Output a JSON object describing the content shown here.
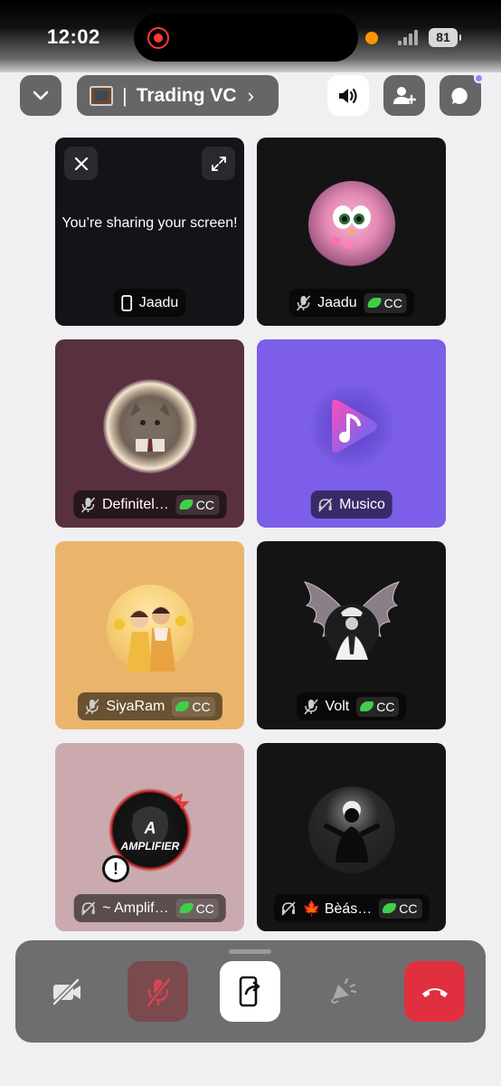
{
  "status_bar": {
    "time": "12:02",
    "battery": "81"
  },
  "header": {
    "channel_name": "Trading VC",
    "channel_separator": "|",
    "channel_chevron": "›"
  },
  "tiles": [
    {
      "name": "Jaadu",
      "kind": "screen-share",
      "text": "You’re sharing your screen!",
      "bg": "#141418",
      "cc": false
    },
    {
      "name": "Jaadu",
      "kind": "user",
      "bg": "#141414",
      "cc": true,
      "cc_label": "CC",
      "avatar": "pink-bird-avatar"
    },
    {
      "name": "Definitel…",
      "kind": "user",
      "bg": "#58303f",
      "cc": true,
      "cc_label": "CC",
      "avatar": "cat-avatar"
    },
    {
      "name": "Musico",
      "kind": "bot",
      "bg": "#7c5ee8",
      "cc": false,
      "avatar": "music-app-avatar"
    },
    {
      "name": "SiyaRam",
      "kind": "user",
      "bg": "#eab56b",
      "cc": true,
      "cc_label": "CC",
      "avatar": "illustrated-couple-avatar"
    },
    {
      "name": "Volt",
      "kind": "user",
      "bg": "#141414",
      "cc": true,
      "cc_label": "CC",
      "avatar": "winged-man-avatar"
    },
    {
      "name": "~ Amplif…",
      "kind": "user",
      "bg": "#caaaae",
      "cc": true,
      "cc_label": "CC",
      "avatar": "amplifier-avatar"
    },
    {
      "name": "🍁 Bèás…",
      "kind": "user",
      "bg": "#141414",
      "cc": true,
      "cc_label": "CC",
      "avatar": "warrior-silhouette-avatar"
    }
  ],
  "controls": {
    "camera": "camera-off-icon",
    "mic": "mic-muted-icon",
    "share": "screen-share-icon",
    "soundboard": "soundboard-icon",
    "end": "hang-up-icon"
  },
  "colors": {
    "accent_end_call": "#e0303f",
    "muted_mic_bg": "#7a4a4d",
    "cc_leaf": "#3fd04a"
  }
}
